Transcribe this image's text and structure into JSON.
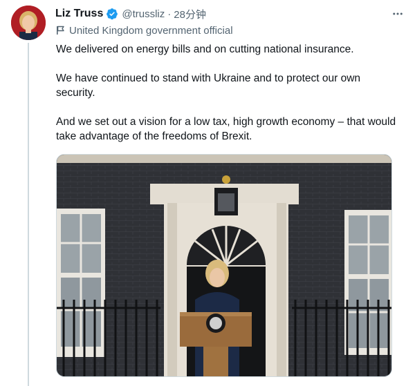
{
  "author": {
    "name": "Liz Truss",
    "handle": "@trussliz",
    "separator": "·",
    "time": "28分钟",
    "verified": true,
    "verified_icon": "verified-badge-icon",
    "label": "United Kingdom government official",
    "label_icon": "flag-icon"
  },
  "tweet": {
    "paragraphs": [
      "We delivered on energy bills and on cutting national insurance.",
      "We have continued to stand with Ukraine and to protect our own security.",
      "And we set out a vision for a low tax, high growth economy – that would take advantage of the freedoms of Brexit."
    ]
  },
  "media": {
    "type": "photo",
    "subject": "woman speaking at lectern in front of black door",
    "icon": "photo-icon"
  },
  "colors": {
    "text": "#0f1419",
    "secondary": "#536471",
    "verified_blue": "#1d9bf0",
    "border": "#cfd9de"
  }
}
